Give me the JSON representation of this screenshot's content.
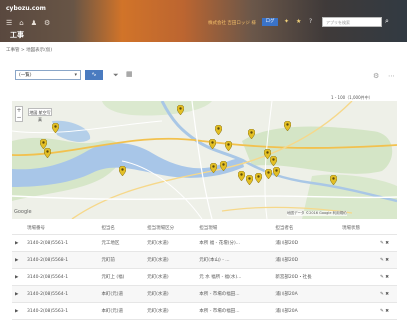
{
  "header": {
    "brand": "cybozu.com",
    "page_title": "工事",
    "user_note": "株式会社 吉田ロッジ 様",
    "login_label": "ログ",
    "search_placeholder": "アプリを検索",
    "icons": [
      "menu-icon",
      "home-icon",
      "people-icon",
      "settings-icon"
    ]
  },
  "breadcrumb": "工事管 > 地図表示(仮)",
  "toolbar": {
    "view_select": "(一覧)",
    "chart_button": "∿"
  },
  "record_info": "1 - 100（1,000件中）",
  "map": {
    "map_type": "地図  航空写真",
    "google_label": "Google",
    "attribution": "地図データ ©2016 Google  利用規約",
    "marker_color": "#e8c52a"
  },
  "table": {
    "columns": [
      "現場番号",
      "担当名",
      "担当現場区分",
      "担当現場",
      "担当者名",
      "現場状態"
    ],
    "rows": [
      [
        "3140-2(08)5561-1",
        "元工地区",
        "元町(水道)",
        "本所 福 - 花壇(分)...",
        "浦川部20D",
        ""
      ],
      [
        "3140-2(08)5568-1",
        "元町前",
        "元町(水道)",
        "元町(本山) - ...",
        "浦川部20D",
        ""
      ],
      [
        "3140-2(08)5564-1",
        "元町上 (福)",
        "元町(水道)",
        "元 水 福所 - 福(水)...",
        "新宮部20D・社長",
        ""
      ],
      [
        "3140-2(08)5564-1",
        "本町(元)道",
        "元町(水道)",
        "本所 - 市場の福田...",
        "浦川部20A",
        ""
      ],
      [
        "3140-2(08)5563-1",
        "本町(元)道",
        "元町(水道)",
        "本所 - 市場の福田...",
        "浦川部20A",
        ""
      ]
    ]
  }
}
